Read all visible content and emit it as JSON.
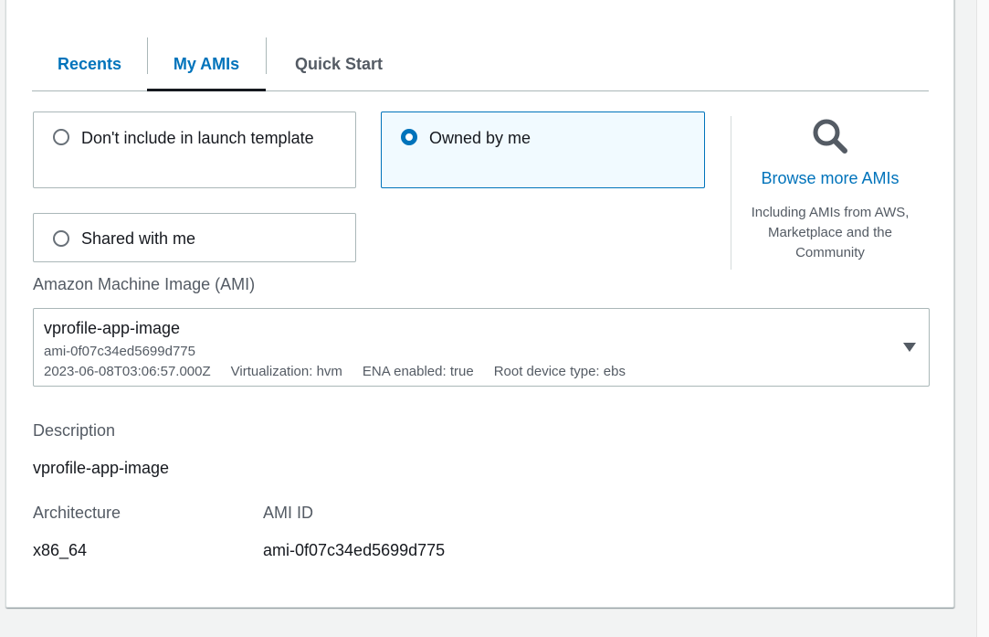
{
  "tabs": [
    {
      "label": "Recents",
      "active": false
    },
    {
      "label": "My AMIs",
      "active": true
    },
    {
      "label": "Quick Start",
      "active": false
    }
  ],
  "source_options": {
    "dont_include": {
      "label": "Don't include in launch template",
      "selected": false
    },
    "owned_by_me": {
      "label": "Owned by me",
      "selected": true
    },
    "shared_with_me": {
      "label": "Shared with me",
      "selected": false
    }
  },
  "browse": {
    "icon": "search-icon",
    "link": "Browse more AMIs",
    "description": "Including AMIs from AWS, Marketplace and the Community"
  },
  "ami_select": {
    "label": "Amazon Machine Image (AMI)",
    "name": "vprofile-app-image",
    "id": "ami-0f07c34ed5699d775",
    "created": "2023-06-08T03:06:57.000Z",
    "virtualization": "Virtualization: hvm",
    "ena": "ENA enabled: true",
    "root_device": "Root device type: ebs"
  },
  "details": {
    "description_label": "Description",
    "description_value": "vprofile-app-image",
    "architecture_label": "Architecture",
    "architecture_value": "x86_64",
    "ami_id_label": "AMI ID",
    "ami_id_value": "ami-0f07c34ed5699d775"
  },
  "colors": {
    "link": "#0073bb",
    "selected_bg": "#f1faff",
    "text": "#16191f",
    "secondary_text": "#545b64"
  }
}
